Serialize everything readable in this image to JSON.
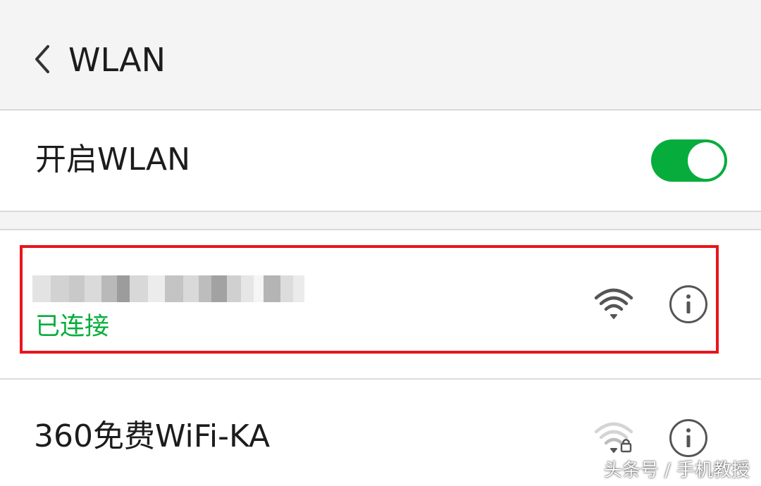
{
  "header": {
    "title": "WLAN",
    "back_icon": "chevron-left-icon"
  },
  "wlan_toggle": {
    "label": "开启WLAN",
    "state": "on",
    "accent_color": "#06ad3c"
  },
  "networks": [
    {
      "ssid": "",
      "ssid_obscured": true,
      "status": "已连接",
      "signal_icon": "wifi-signal-icon",
      "signal_strength": "full",
      "secured": false,
      "info_icon": "info-icon",
      "highlighted": true,
      "highlight_color": "#e8141c"
    },
    {
      "ssid": "360免费WiFi-KA",
      "status": "",
      "signal_icon": "wifi-signal-lock-icon",
      "signal_strength": "weak",
      "secured": true,
      "info_icon": "info-icon",
      "highlighted": false
    }
  ],
  "watermark": "头条号 / 手机教授"
}
